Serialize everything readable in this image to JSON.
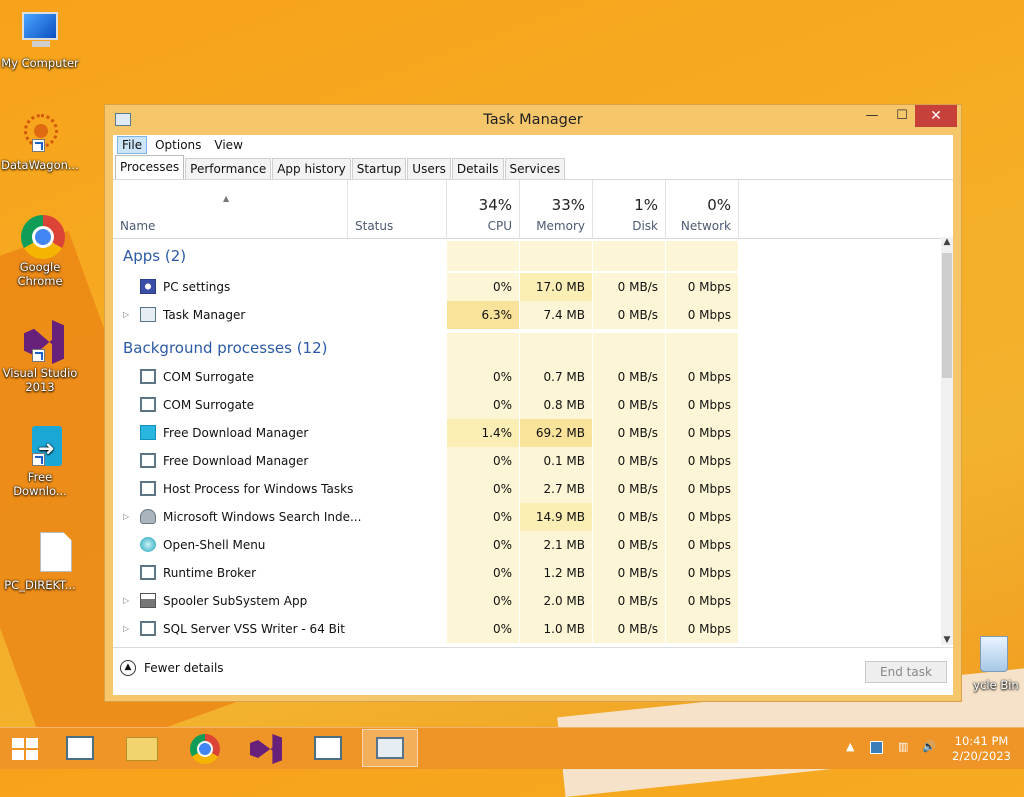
{
  "desktop": {
    "icons": [
      {
        "label": "My Computer"
      },
      {
        "label": "DataWagon..."
      },
      {
        "label": "Google Chrome"
      },
      {
        "label": "Visual Studio 2013"
      },
      {
        "label": "Free Downlo..."
      },
      {
        "label": "PC_DIREKT..."
      },
      {
        "label": "ycle Bin"
      }
    ]
  },
  "window": {
    "title": "Task Manager",
    "controls": {
      "minimize": "—",
      "maximize": "☐",
      "close": "✕"
    }
  },
  "menu": [
    "File",
    "Options",
    "View"
  ],
  "tabs": [
    "Processes",
    "Performance",
    "App history",
    "Startup",
    "Users",
    "Details",
    "Services"
  ],
  "columns": {
    "name": "Name",
    "status": "Status",
    "cpu": {
      "pct": "34%",
      "label": "CPU"
    },
    "memory": {
      "pct": "33%",
      "label": "Memory"
    },
    "disk": {
      "pct": "1%",
      "label": "Disk"
    },
    "network": {
      "pct": "0%",
      "label": "Network"
    }
  },
  "groups": {
    "apps": "Apps (2)",
    "background": "Background processes (12)"
  },
  "apps": [
    {
      "name": "PC settings",
      "cpu": "0%",
      "mem": "17.0 MB",
      "disk": "0 MB/s",
      "net": "0 Mbps",
      "icon": "gear-icon",
      "expand": false
    },
    {
      "name": "Task Manager",
      "cpu": "6.3%",
      "mem": "7.4 MB",
      "disk": "0 MB/s",
      "net": "0 Mbps",
      "icon": "taskmanager-icon",
      "expand": true
    }
  ],
  "background": [
    {
      "name": "COM Surrogate",
      "cpu": "0%",
      "mem": "0.7 MB",
      "disk": "0 MB/s",
      "net": "0 Mbps",
      "icon": "window-icon",
      "expand": false
    },
    {
      "name": "COM Surrogate",
      "cpu": "0%",
      "mem": "0.8 MB",
      "disk": "0 MB/s",
      "net": "0 Mbps",
      "icon": "window-icon",
      "expand": false
    },
    {
      "name": "Free Download Manager",
      "cpu": "1.4%",
      "mem": "69.2 MB",
      "disk": "0 MB/s",
      "net": "0 Mbps",
      "icon": "download-icon",
      "expand": false
    },
    {
      "name": "Free Download Manager",
      "cpu": "0%",
      "mem": "0.1 MB",
      "disk": "0 MB/s",
      "net": "0 Mbps",
      "icon": "window-icon",
      "expand": false
    },
    {
      "name": "Host Process for Windows Tasks",
      "cpu": "0%",
      "mem": "2.7 MB",
      "disk": "0 MB/s",
      "net": "0 Mbps",
      "icon": "window-icon",
      "expand": false
    },
    {
      "name": "Microsoft Windows Search Inde...",
      "cpu": "0%",
      "mem": "14.9 MB",
      "disk": "0 MB/s",
      "net": "0 Mbps",
      "icon": "search-person-icon",
      "expand": true
    },
    {
      "name": "Open-Shell Menu",
      "cpu": "0%",
      "mem": "2.1 MB",
      "disk": "0 MB/s",
      "net": "0 Mbps",
      "icon": "shell-icon",
      "expand": false
    },
    {
      "name": "Runtime Broker",
      "cpu": "0%",
      "mem": "1.2 MB",
      "disk": "0 MB/s",
      "net": "0 Mbps",
      "icon": "window-icon",
      "expand": false
    },
    {
      "name": "Spooler SubSystem App",
      "cpu": "0%",
      "mem": "2.0 MB",
      "disk": "0 MB/s",
      "net": "0 Mbps",
      "icon": "printer-icon",
      "expand": true
    },
    {
      "name": "SQL Server VSS Writer - 64 Bit",
      "cpu": "0%",
      "mem": "1.0 MB",
      "disk": "0 MB/s",
      "net": "0 Mbps",
      "icon": "window-icon",
      "expand": true
    }
  ],
  "footer": {
    "fewer": "Fewer details",
    "endtask": "End task"
  },
  "taskbar": {
    "time": "10:41 PM",
    "date": "2/20/2023"
  },
  "colors": {
    "accent_orange": "#f7a21a",
    "heat_light": "#fdf6d6",
    "heat_mid": "#fbeeb4",
    "heat_high": "#f9e39a",
    "group_blue": "#2c5aa6"
  }
}
